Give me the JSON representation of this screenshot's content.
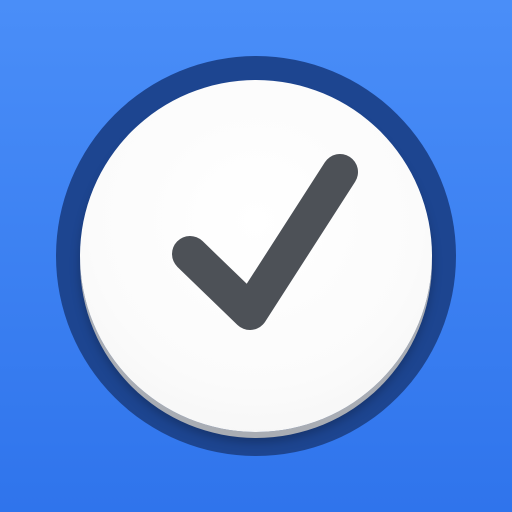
{
  "icon": {
    "name": "checkmark-clock-app-icon",
    "colors": {
      "background_top": "#4a8ef8",
      "background_bottom": "#2f74ec",
      "ring": "#1d4590",
      "face": "#ffffff",
      "check": "#4d5157"
    },
    "symbol": "checkmark-icon"
  }
}
